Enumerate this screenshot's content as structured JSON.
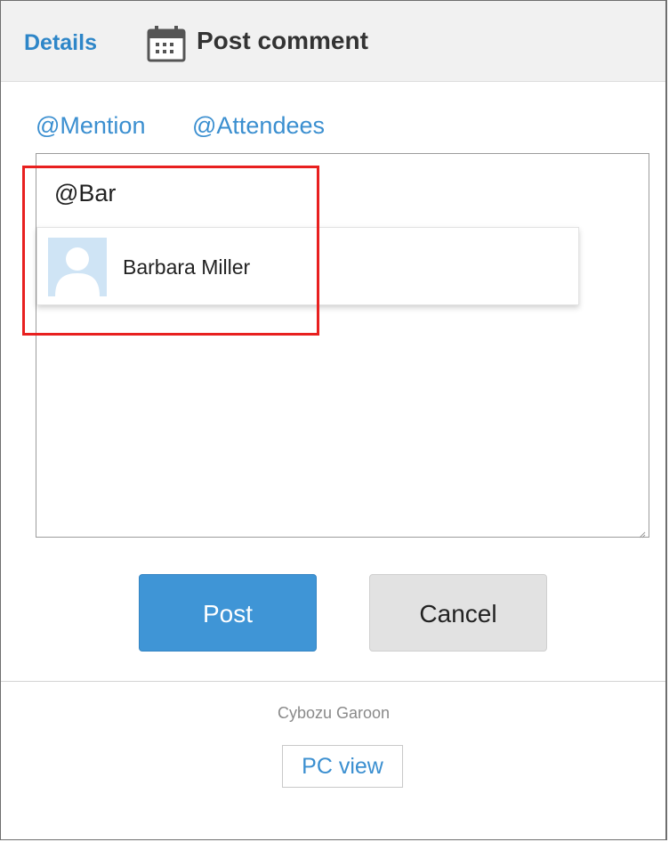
{
  "header": {
    "details_label": "Details",
    "title": "Post comment",
    "title_icon": "calendar-icon"
  },
  "mentions": {
    "mention_label": "@Mention",
    "attendees_label": "@Attendees"
  },
  "comment": {
    "value": "@Bar"
  },
  "suggestion": {
    "name": "Barbara Miller",
    "avatar_icon": "user-silhouette-icon"
  },
  "actions": {
    "post_label": "Post",
    "cancel_label": "Cancel"
  },
  "footer": {
    "app_name": "Cybozu Garoon",
    "pc_view_label": "PC view"
  },
  "colors": {
    "link_blue": "#2e86c8",
    "primary_button": "#3f95d6",
    "secondary_button": "#e2e2e2",
    "highlight_red": "#e8201f",
    "header_bg": "#f1f1f1"
  }
}
